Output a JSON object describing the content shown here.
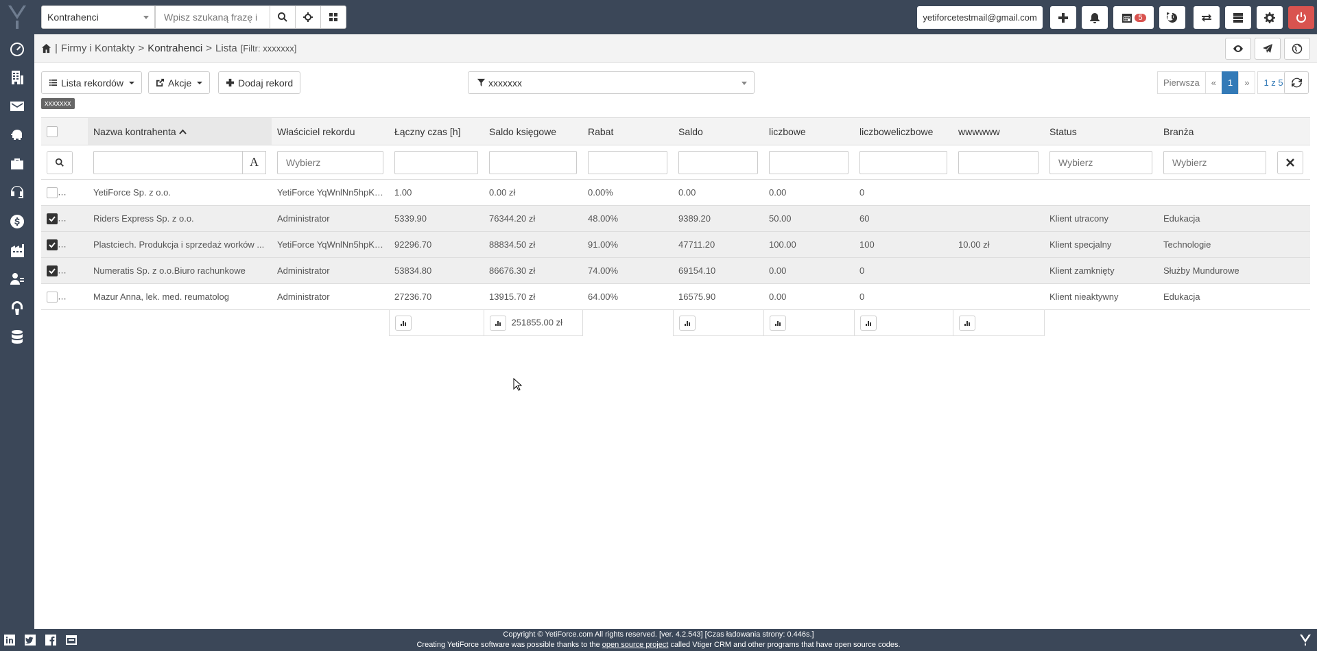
{
  "topbar": {
    "module": "Kontrahenci",
    "search_placeholder": "Wpisz szukaną frazę i",
    "email": "yetiforcetestmail@gmail.com",
    "calendar_badge": "5"
  },
  "breadcrumb": {
    "part1": "Firmy i Kontakty",
    "sep": ">",
    "part2": "Kontrahenci",
    "part3": "Lista",
    "filter": "[Filtr: xxxxxxx]"
  },
  "toolbar": {
    "list_label": "Lista rekordów",
    "actions_label": "Akcje",
    "add_label": "Dodaj rekord",
    "filter_value": "xxxxxxx",
    "tag": "xxxxxxx"
  },
  "pager": {
    "first": "Pierwsza",
    "prev": "«",
    "current": "1",
    "next": "»",
    "count": "1 z 5"
  },
  "table": {
    "headers": [
      "Nazwa kontrahenta",
      "Właściciel rekordu",
      "Łączny czas [h]",
      "Saldo księgowe",
      "Rabat",
      "Saldo",
      "liczbowe",
      "liczboweliczbowe",
      "wwwwww",
      "Status",
      "Branża"
    ],
    "placeholders": {
      "owner": "Wybierz",
      "status": "Wybierz",
      "industry": "Wybierz"
    },
    "rows": [
      {
        "checked": false,
        "cells": [
          "YetiForce Sp. z o.o.",
          "YetiForce YqWnlNn5hpK@",
          "1.00",
          "0.00 zł",
          "0.00%",
          "0.00",
          "0.00",
          "0",
          "",
          "",
          ""
        ]
      },
      {
        "checked": true,
        "cells": [
          "Riders Express Sp. z o.o.",
          "Administrator",
          "5339.90",
          "76344.20 zł",
          "48.00%",
          "9389.20",
          "50.00",
          "60",
          "",
          "Klient utracony",
          "Edukacja"
        ]
      },
      {
        "checked": true,
        "cells": [
          "Plastciech. Produkcja i sprzedaż worków ...",
          "YetiForce YqWnlNn5hpK@",
          "92296.70",
          "88834.50 zł",
          "91.00%",
          "47711.20",
          "100.00",
          "100",
          "10.00 zł",
          "Klient specjalny",
          "Technologie"
        ]
      },
      {
        "checked": true,
        "cells": [
          "Numeratis Sp. z o.o.Biuro rachunkowe",
          "Administrator",
          "53834.80",
          "86676.30 zł",
          "74.00%",
          "69154.10",
          "0.00",
          "0",
          "",
          "Klient zamknięty",
          "Służby Mundurowe"
        ]
      },
      {
        "checked": false,
        "cells": [
          "Mazur Anna, lek. med. reumatolog",
          "Administrator",
          "27236.70",
          "13915.70 zł",
          "64.00%",
          "16575.90",
          "0.00",
          "0",
          "",
          "Klient nieaktywny",
          "Edukacja"
        ]
      }
    ],
    "sum_balance": "251855.00 zł"
  },
  "footer": {
    "line1": "Copyright © YetiForce.com All rights reserved. [ver. 4.2.543] [Czas ładowania strony: 0.446s.]",
    "line2_pre": "Creating YetiForce software was possible thanks to the",
    "line2_link": "open source project",
    "line2_post": "called Vtiger CRM and other programs that have open source codes."
  }
}
